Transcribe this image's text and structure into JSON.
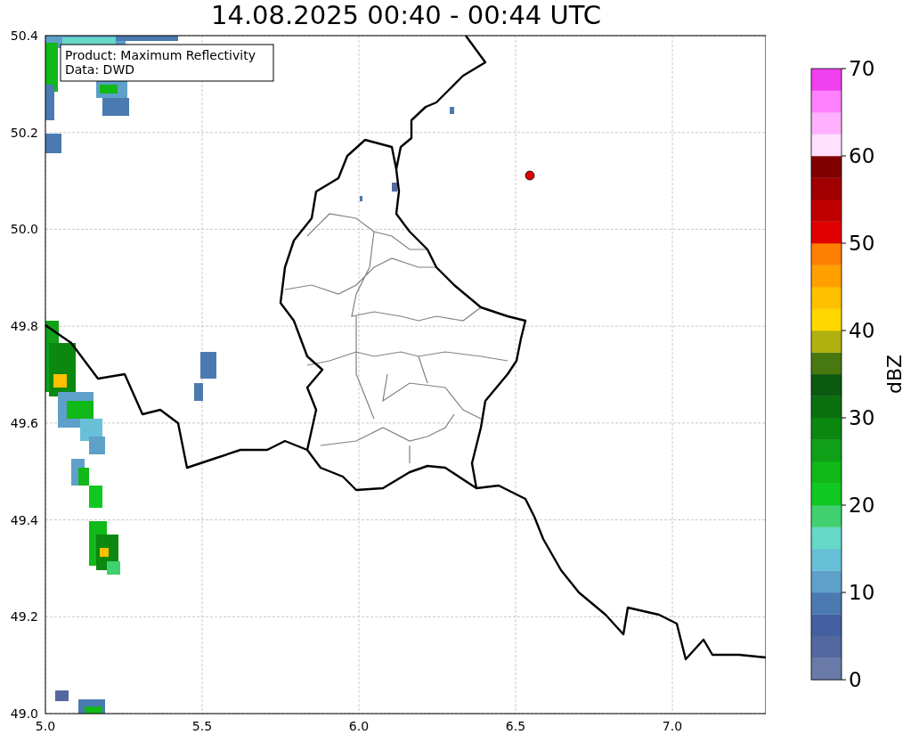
{
  "title": "14.08.2025 00:40 - 00:44 UTC",
  "legend": [
    "Product: Maximum Reflectivity",
    "Data: DWD"
  ],
  "x_ticks": [
    "5.0",
    "5.5",
    "6.0",
    "6.5",
    "7.0"
  ],
  "y_ticks": [
    "50.4",
    "50.2",
    "50.0",
    "49.8",
    "49.6",
    "49.4",
    "49.2",
    "49.0"
  ],
  "colorbar": {
    "label": "dBZ",
    "ticks": [
      "70",
      "60",
      "50",
      "40",
      "30",
      "20",
      "10",
      "0"
    ],
    "segments": [
      {
        "color": "#6a7aa8"
      },
      {
        "color": "#5468a0"
      },
      {
        "color": "#4460a0"
      },
      {
        "color": "#4a7ab0"
      },
      {
        "color": "#5ea0c8"
      },
      {
        "color": "#68c0d8"
      },
      {
        "color": "#66d8c8"
      },
      {
        "color": "#40d070"
      },
      {
        "color": "#10c820"
      },
      {
        "color": "#10b818"
      },
      {
        "color": "#10a018"
      },
      {
        "color": "#0a8810"
      },
      {
        "color": "#0a7010"
      },
      {
        "color": "#0a5a10"
      },
      {
        "color": "#487810"
      },
      {
        "color": "#b0b010"
      },
      {
        "color": "#ffd800"
      },
      {
        "color": "#ffc000"
      },
      {
        "color": "#ffa000"
      },
      {
        "color": "#ff8000"
      },
      {
        "color": "#e00000"
      },
      {
        "color": "#c00000"
      },
      {
        "color": "#a00000"
      },
      {
        "color": "#800000"
      },
      {
        "color": "#ffe0ff"
      },
      {
        "color": "#ffb0ff"
      },
      {
        "color": "#ff80ff"
      },
      {
        "color": "#f040f0"
      }
    ]
  }
}
